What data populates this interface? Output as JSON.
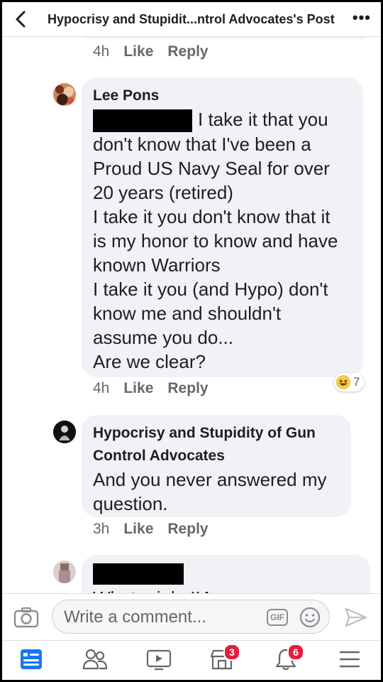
{
  "header": {
    "title": "Hypocrisy and Stupidit...ntrol Advocates's Post",
    "back_icon": "chevron-left-icon",
    "more_label": "•••"
  },
  "comments": [
    {
      "time": "4h",
      "like_label": "Like",
      "reply_label": "Reply"
    },
    {
      "author": "Lee Pons",
      "lines": [
        "I take it that you",
        "don't know that I've been a",
        "Proud US Navy Seal for over",
        "20 years (retired)",
        "I take it you don't know that it",
        "is my honor to know and have",
        "known Warriors",
        "I take it you (and Hypo) don't",
        "know me and shouldn't",
        "assume you do...",
        "Are we clear?"
      ],
      "reaction_count": "7",
      "reaction_icon": "haha-emoji-icon",
      "time": "4h",
      "like_label": "Like",
      "reply_label": "Reply"
    },
    {
      "author_line1": "Hypocrisy and Stupidity of Gun",
      "author_line2": "Control Advocates",
      "lines": [
        "And you never answered my",
        "question."
      ],
      "time": "3h",
      "like_label": "Like",
      "reply_label": "Reply"
    },
    {
      "partial_text": "What a joke!!Are we"
    }
  ],
  "composer": {
    "placeholder": "Write a comment...",
    "gif_label": "GIF"
  },
  "nav": {
    "items": [
      {
        "icon": "news-feed-icon",
        "active": true
      },
      {
        "icon": "friends-icon"
      },
      {
        "icon": "watch-icon"
      },
      {
        "icon": "marketplace-icon",
        "badge": "3"
      },
      {
        "icon": "notifications-bell-icon",
        "badge": "6"
      },
      {
        "icon": "menu-icon"
      }
    ]
  },
  "colors": {
    "accent": "#1877f2",
    "bubble": "#f0f2f5",
    "meta_text": "#65676b",
    "badge": "#e41e3f"
  }
}
